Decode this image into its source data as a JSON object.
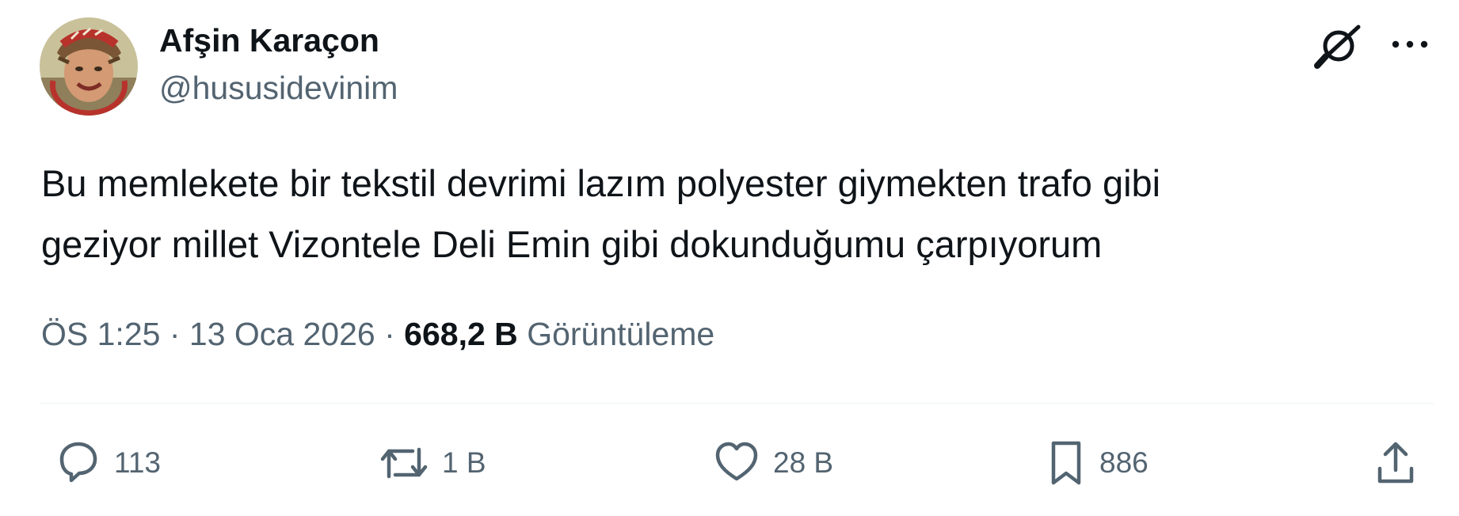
{
  "author": {
    "display_name": "Afşin Karaçon",
    "handle": "@hususidevinim",
    "avatar_icon": "profile-avatar"
  },
  "tweet": {
    "text": "Bu memlekete bir tekstil devrimi lazım polyester giymekten trafo gibi\ngeziyor millet Vizontele Deli Emin gibi dokunduğumu çarpıyorum"
  },
  "meta": {
    "time": "ÖS 1:25",
    "separator": "·",
    "date": "13 Oca 2026",
    "views_count": "668,2 B",
    "views_label": "Görüntüleme"
  },
  "actions": {
    "replies": "113",
    "retweets": "1 B",
    "likes": "28 B",
    "bookmarks": "886"
  },
  "icons": {
    "grok": "grok-icon",
    "more": "more-icon",
    "reply": "reply-icon",
    "retweet": "retweet-icon",
    "like": "heart-icon",
    "bookmark": "bookmark-icon",
    "share": "share-icon"
  },
  "colors": {
    "primary_text": "#0f1419",
    "secondary_text": "#536471",
    "divider": "#eff3f4"
  }
}
